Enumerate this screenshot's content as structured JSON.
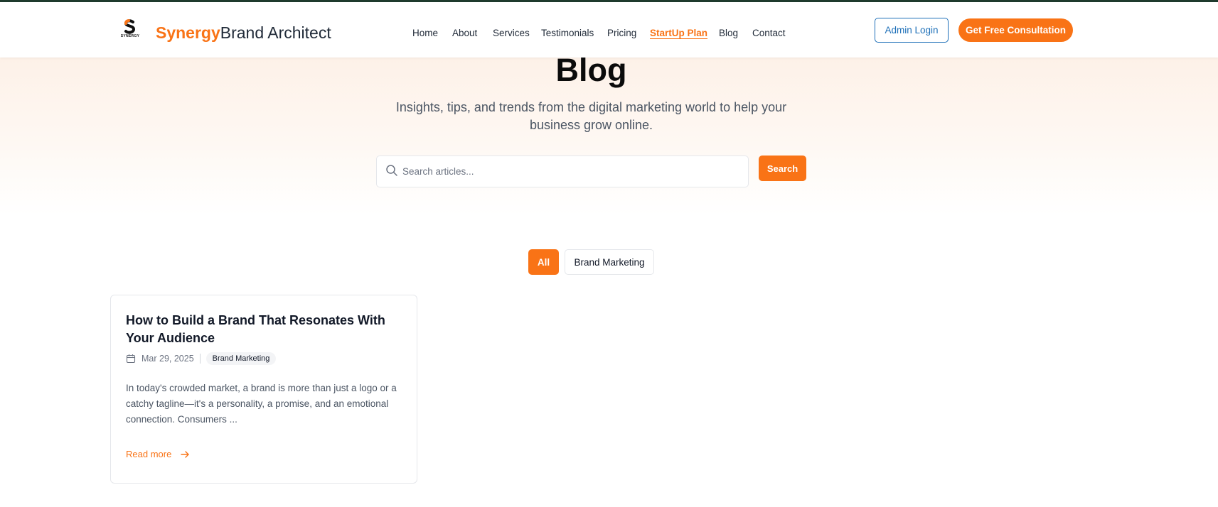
{
  "header": {
    "logo_small_text": "SYNERGY",
    "brand_accent": "Synergy",
    "brand_rest": "Brand Architect",
    "nav": [
      {
        "label": "Home",
        "active": false
      },
      {
        "label": "About",
        "active": false
      },
      {
        "label": "Services",
        "active": false
      },
      {
        "label": "Testimonials",
        "active": false
      },
      {
        "label": "Pricing",
        "active": false
      },
      {
        "label": "StartUp Plan",
        "active": true
      },
      {
        "label": "Blog",
        "active": false
      },
      {
        "label": "Contact",
        "active": false
      }
    ],
    "admin_login_label": "Admin Login",
    "consultation_label": "Get Free Consultation"
  },
  "hero": {
    "title": "Blog",
    "subtitle": "Insights, tips, and trends from the digital marketing world to help your business grow online.",
    "search_placeholder": "Search articles...",
    "search_value": "",
    "search_button_label": "Search"
  },
  "filters": {
    "items": [
      {
        "label": "All",
        "selected": true
      },
      {
        "label": "Brand Marketing",
        "selected": false
      }
    ]
  },
  "posts": [
    {
      "title": "How to Build a Brand That Resonates With Your Audience",
      "date": "Mar 29, 2025",
      "category": "Brand Marketing",
      "excerpt": "In today's crowded market, a brand is more than just a logo or a catchy tagline—it's a personality, a promise, and an emotional connection. Consumers ...",
      "read_more_label": "Read more"
    }
  ],
  "icons": {
    "logo": "synergy-s-logo-icon",
    "search": "search-icon",
    "date": "calendar-icon",
    "read_more": "arrow-right-icon"
  },
  "colors": {
    "accent": "#f97316",
    "admin_blue": "#1d6fb8",
    "top_bar": "#1f3b2e",
    "hero_tint": "#fdf1e8"
  }
}
